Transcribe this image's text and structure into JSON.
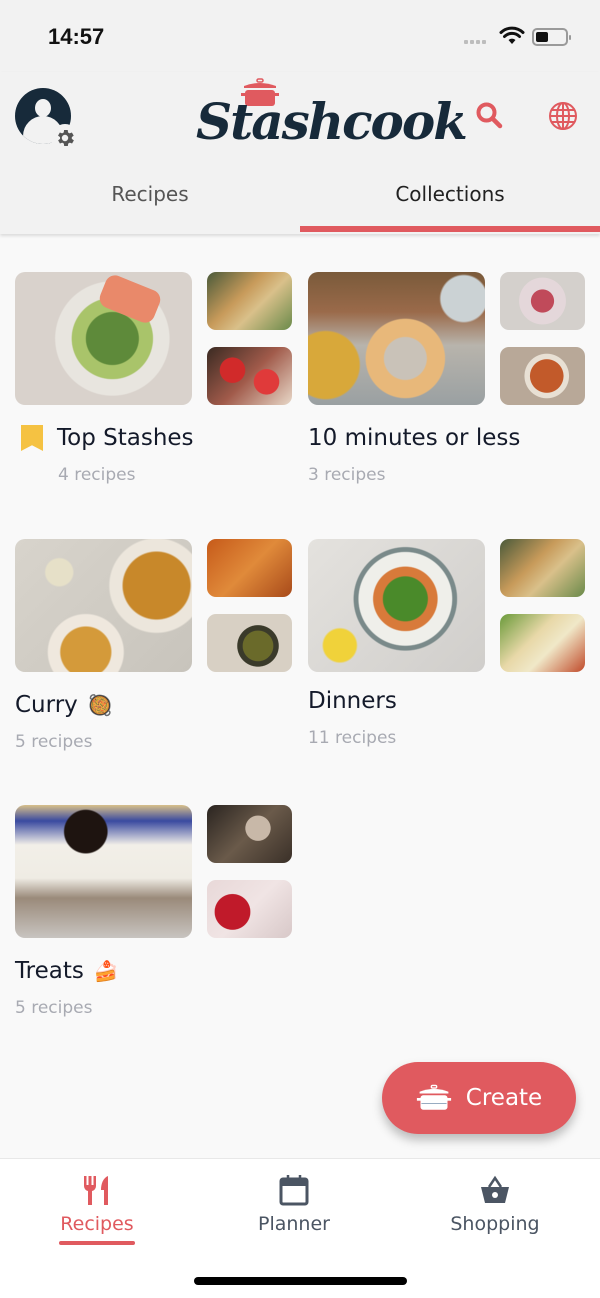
{
  "status_bar": {
    "time": "14:57"
  },
  "header": {
    "logo_text": "Stashcook",
    "icons": {
      "avatar": "user-avatar-icon",
      "settings": "gear-icon",
      "search": "search-icon",
      "language": "globe-icon"
    }
  },
  "tabs": [
    {
      "label": "Recipes",
      "active": false
    },
    {
      "label": "Collections",
      "active": true
    }
  ],
  "collections": [
    {
      "title": "Top Stashes",
      "count": "4 recipes",
      "icon": "bookmark-icon",
      "emoji": ""
    },
    {
      "title": "10 minutes or less",
      "count": "3 recipes",
      "icon": "",
      "emoji": ""
    },
    {
      "title": "Curry",
      "count": "5 recipes",
      "icon": "",
      "emoji": "🥘"
    },
    {
      "title": "Dinners",
      "count": "11 recipes",
      "icon": "",
      "emoji": ""
    },
    {
      "title": "Treats",
      "count": "5 recipes",
      "icon": "",
      "emoji": "🍰"
    }
  ],
  "fab": {
    "label": "Create",
    "icon": "pot-icon"
  },
  "bottom_nav": [
    {
      "label": "Recipes",
      "icon": "fork-knife-icon",
      "active": true
    },
    {
      "label": "Planner",
      "icon": "calendar-icon",
      "active": false
    },
    {
      "label": "Shopping",
      "icon": "basket-icon",
      "active": false
    }
  ],
  "colors": {
    "accent": "#e05a5f",
    "navy": "#172a3a",
    "bookmark": "#f5c242",
    "muted_text": "#a8aab2"
  }
}
